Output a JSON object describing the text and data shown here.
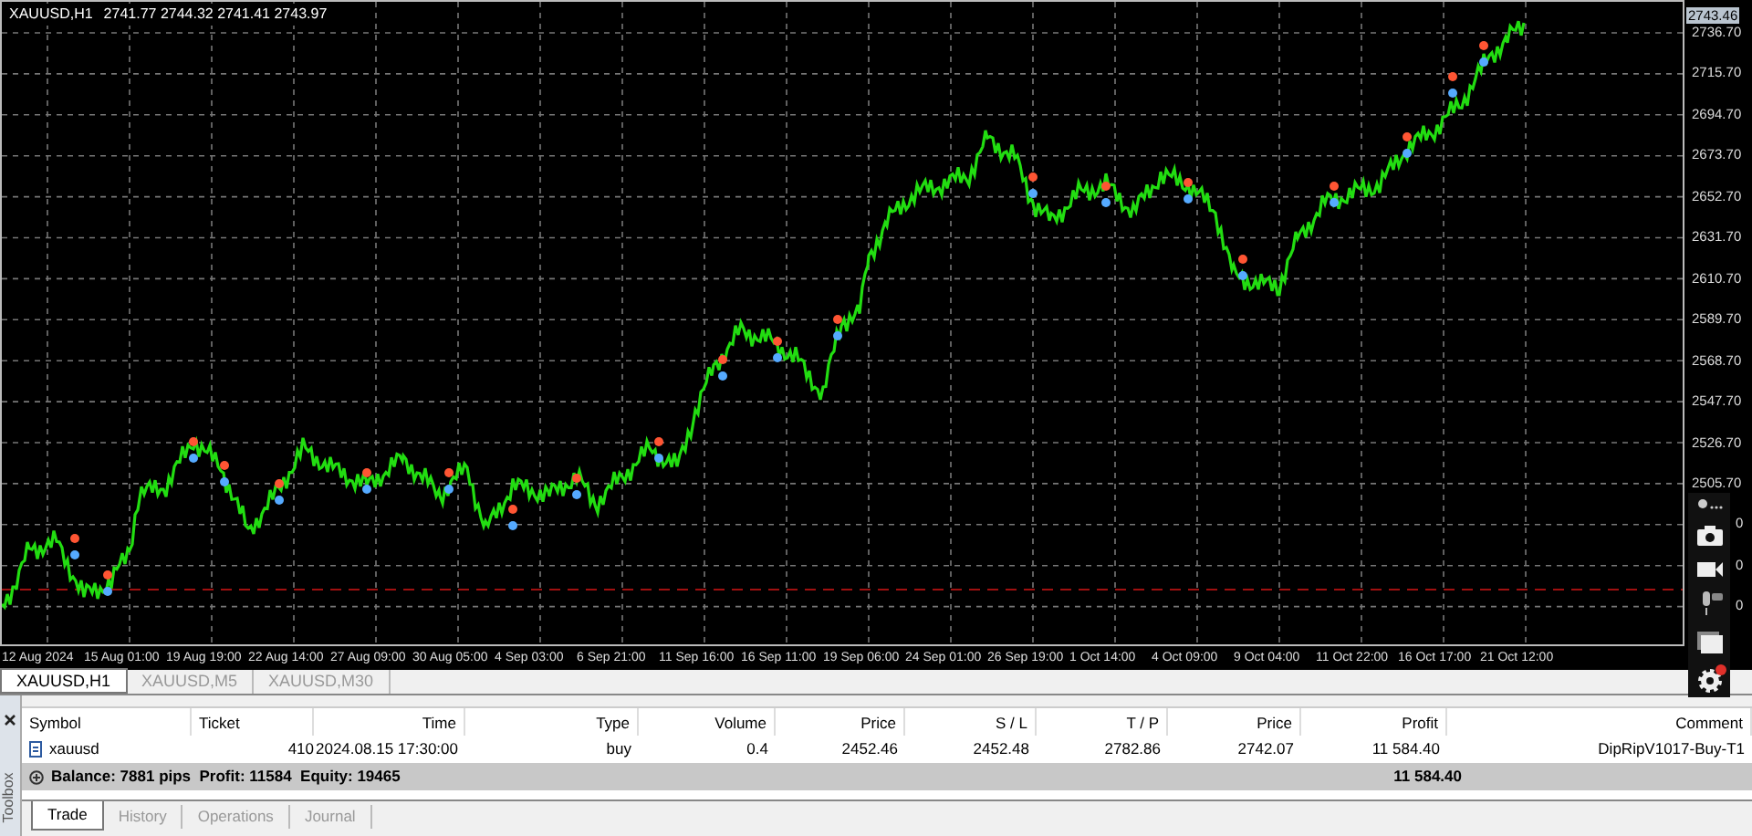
{
  "chart": {
    "symbol": "XAUUSD,H1",
    "ohlc": "2741.77 2744.32 2741.41 2743.97",
    "current_price": "2743.46",
    "price_ticks": [
      "2736.70",
      "2715.70",
      "2694.70",
      "2673.70",
      "2652.70",
      "2631.70",
      "2610.70",
      "2589.70",
      "2568.70",
      "2547.70",
      "2526.70",
      "2505.70",
      "0",
      "0",
      "0"
    ],
    "time_ticks": [
      "12 Aug 2024",
      "15 Aug 01:00",
      "19 Aug 19:00",
      "22 Aug 14:00",
      "27 Aug 09:00",
      "30 Aug 05:00",
      "4 Sep 03:00",
      "6 Sep 21:00",
      "11 Sep 16:00",
      "16 Sep 11:00",
      "19 Sep 06:00",
      "24 Sep 01:00",
      "26 Sep 19:00",
      "1 Oct 14:00",
      "4 Oct 09:00",
      "9 Oct 04:00",
      "11 Oct 22:00",
      "16 Oct 17:00",
      "21 Oct 12:00"
    ]
  },
  "chart_tabs": [
    {
      "label": "XAUUSD,H1",
      "selected": true
    },
    {
      "label": "XAUUSD,M5",
      "selected": false
    },
    {
      "label": "XAUUSD,M30",
      "selected": false
    }
  ],
  "toolbox": {
    "title": "Toolbox"
  },
  "table": {
    "columns": [
      "Symbol",
      "Ticket",
      "Time",
      "Type",
      "Volume",
      "Price",
      "S / L",
      "T / P",
      "Price",
      "Profit",
      "Comment"
    ],
    "rows": [
      [
        "xauusd",
        "410",
        "2024.08.15 17:30:00",
        "buy",
        "0.4",
        "2452.46",
        "2452.48",
        "2782.86",
        "2742.07",
        "11 584.40",
        "DipRipV1017-Buy-T1"
      ]
    ],
    "summary": {
      "text": "Balance: 7881 pips  Profit: 11584  Equity: 19465",
      "total": "11 584.40"
    }
  },
  "bottom_tabs": [
    {
      "label": "Trade",
      "selected": true
    },
    {
      "label": "History",
      "selected": false
    },
    {
      "label": "Operations",
      "selected": false
    },
    {
      "label": "Journal",
      "selected": false
    }
  ]
}
